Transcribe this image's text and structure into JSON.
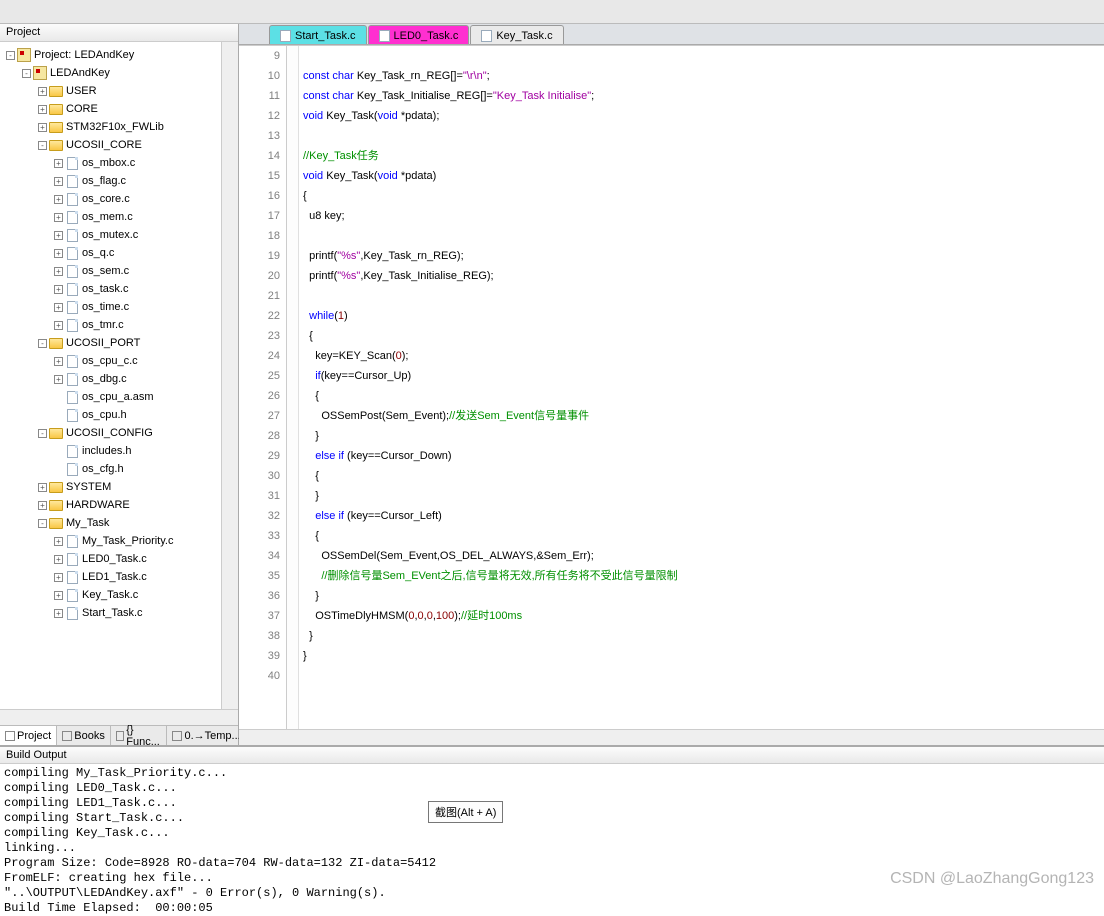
{
  "panel_title": "Project",
  "tree": {
    "root": "Project: LEDAndKey",
    "pkg": "LEDAndKey",
    "groups": [
      {
        "n": "USER",
        "t": "+",
        "c": []
      },
      {
        "n": "CORE",
        "t": "+",
        "c": []
      },
      {
        "n": "STM32F10x_FWLib",
        "t": "+",
        "c": []
      },
      {
        "n": "UCOSII_CORE",
        "t": "-",
        "c": [
          "os_mbox.c",
          "os_flag.c",
          "os_core.c",
          "os_mem.c",
          "os_mutex.c",
          "os_q.c",
          "os_sem.c",
          "os_task.c",
          "os_time.c",
          "os_tmr.c"
        ]
      },
      {
        "n": "UCOSII_PORT",
        "t": "-",
        "c": [
          "os_cpu_c.c",
          "os_dbg.c",
          "os_cpu_a.asm",
          "os_cpu.h"
        ]
      },
      {
        "n": "UCOSII_CONFIG",
        "t": "-",
        "c": [
          "includes.h",
          "os_cfg.h"
        ]
      },
      {
        "n": "SYSTEM",
        "t": "+",
        "c": []
      },
      {
        "n": "HARDWARE",
        "t": "+",
        "c": []
      },
      {
        "n": "My_Task",
        "t": "-",
        "c": [
          "My_Task_Priority.c",
          "LED0_Task.c",
          "LED1_Task.c",
          "Key_Task.c",
          "Start_Task.c"
        ]
      }
    ]
  },
  "side_tabs": [
    {
      "l": "Project",
      "active": true
    },
    {
      "l": "Books",
      "active": false
    },
    {
      "l": "{} Func...",
      "active": false
    },
    {
      "l": "0.→Temp...",
      "active": false
    }
  ],
  "ed_tabs": [
    {
      "l": "Start_Task.c",
      "cls": "t0"
    },
    {
      "l": "LED0_Task.c",
      "cls": "t1"
    },
    {
      "l": "Key_Task.c",
      "cls": "t2"
    }
  ],
  "code": {
    "start": 9,
    "lines": [
      {
        "h": ""
      },
      {
        "h": "<span class='kw'>const</span> <span class='ty'>char</span> Key_Task_rn_REG[]=<span class='st'>\"\\r\\n\"</span>;"
      },
      {
        "h": "<span class='kw'>const</span> <span class='ty'>char</span> Key_Task_Initialise_REG[]=<span class='st'>\"Key_Task Initialise\"</span>;"
      },
      {
        "h": "<span class='ty'>void</span> Key_Task(<span class='ty'>void</span> *pdata);"
      },
      {
        "h": ""
      },
      {
        "h": "<span class='cm'>//Key_Task任务</span>"
      },
      {
        "h": "<span class='ty'>void</span> Key_Task(<span class='ty'>void</span> *pdata)"
      },
      {
        "h": "{"
      },
      {
        "h": "  u8 key;"
      },
      {
        "h": ""
      },
      {
        "h": "  printf(<span class='st'>\"%s\"</span>,Key_Task_rn_REG);"
      },
      {
        "h": "  printf(<span class='st'>\"%s\"</span>,Key_Task_Initialise_REG);"
      },
      {
        "h": ""
      },
      {
        "h": "  <span class='kw'>while</span>(<span class='nm'>1</span>)"
      },
      {
        "h": "  {"
      },
      {
        "h": "    key=KEY_Scan(<span class='nm'>0</span>);"
      },
      {
        "h": "    <span class='kw'>if</span>(key==Cursor_Up)"
      },
      {
        "h": "    {"
      },
      {
        "h": "      OSSemPost(Sem_Event);<span class='cm'>//发送Sem_Event信号量事件</span>"
      },
      {
        "h": "    }"
      },
      {
        "h": "    <span class='kw'>else</span> <span class='kw'>if</span> (key==Cursor_Down)"
      },
      {
        "h": "    {"
      },
      {
        "h": "    }"
      },
      {
        "h": "    <span class='kw'>else</span> <span class='kw'>if</span> (key==Cursor_Left)"
      },
      {
        "h": "    {"
      },
      {
        "h": "      OSSemDel(Sem_Event,OS_DEL_ALWAYS,&Sem_Err);"
      },
      {
        "h": "      <span class='cm'>//删除信号量Sem_EVent之后,信号量将无效,所有任务将不受此信号量限制</span>"
      },
      {
        "h": "    }"
      },
      {
        "h": "    OSTimeDlyHMSM(<span class='nm'>0</span>,<span class='nm'>0</span>,<span class='nm'>0</span>,<span class='nm'>100</span>);<span class='cm'>//延时100ms</span>"
      },
      {
        "h": "  }"
      },
      {
        "h": "}"
      },
      {
        "h": ""
      }
    ]
  },
  "tooltip": "截图(Alt + A)",
  "build_title": "Build Output",
  "build_lines": [
    "compiling My_Task_Priority.c...",
    "compiling LED0_Task.c...",
    "compiling LED1_Task.c...",
    "compiling Start_Task.c...",
    "compiling Key_Task.c...",
    "linking...",
    "Program Size: Code=8928 RO-data=704 RW-data=132 ZI-data=5412",
    "FromELF: creating hex file...",
    "\"..\\OUTPUT\\LEDAndKey.axf\" - 0 Error(s), 0 Warning(s).",
    "Build Time Elapsed:  00:00:05"
  ],
  "watermark": "CSDN @LaoZhangGong123"
}
